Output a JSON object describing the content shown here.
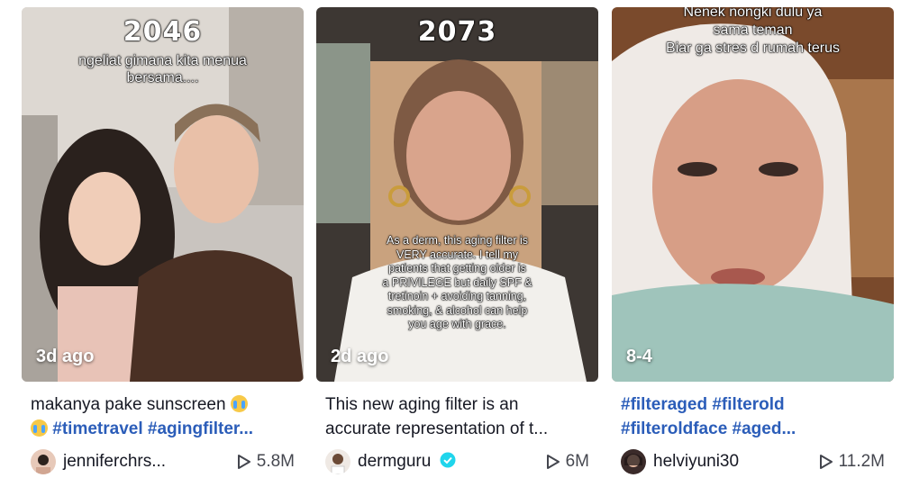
{
  "videos": [
    {
      "overlay_title": "2046",
      "overlay_caption_line1": "ngeliat gimana kita menua",
      "overlay_caption_line2": "bersama....",
      "date": "3d ago",
      "description_text": "makanya pake sunscreen",
      "hashtags": "#timetravel #agingfilter...",
      "username": "jenniferchrs...",
      "views": "5.8M"
    },
    {
      "overlay_title": "2073",
      "overlay_caption_line1": "As a derm, this aging filter is",
      "overlay_caption_line2": "VERY accurate. I tell my",
      "overlay_caption_line3": "patients that getting older is",
      "overlay_caption_line4": "a PRIVILEGE but daily SPF &",
      "overlay_caption_line5": "tretinoin + avoiding tanning,",
      "overlay_caption_line6": "smoking, & alcohol can help",
      "overlay_caption_line7": "you age with grace.",
      "date": "2d ago",
      "description_line1": "This new aging filter is an",
      "description_line2": "accurate representation of t...",
      "username": "dermguru",
      "verified": true,
      "views": "6M"
    },
    {
      "overlay_caption_line0": "Nenek nongki dulu ya",
      "overlay_caption_line1": "sama teman",
      "overlay_caption_line2": "Biar ga stres d rumah  terus",
      "date": "8-4",
      "description_line1": "#filteraged #filterold",
      "description_line2": "#filteroldface #aged...",
      "username": "helviyuni30",
      "views": "11.2M"
    }
  ],
  "icons": {
    "play": "play-outline-icon",
    "verified": "verified-badge-icon",
    "emoji": "crying-face-emoji"
  },
  "colors": {
    "hashtag": "#2b5db9",
    "verified": "#20d5ec",
    "text": "#161823"
  }
}
